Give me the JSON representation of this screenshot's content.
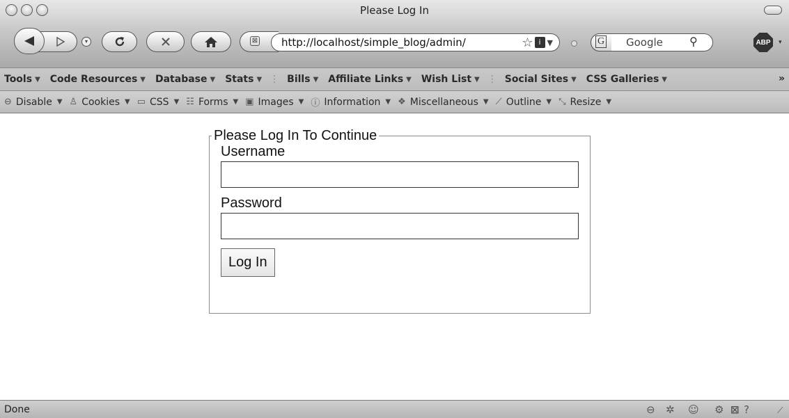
{
  "window": {
    "title": "Please Log In"
  },
  "nav": {
    "back_icon": "back-arrow-icon",
    "forward_icon": "forward-arrow-icon",
    "url": "http://localhost/simple_blog/admin/",
    "search_placeholder": "Google",
    "abp_label": "ABP"
  },
  "bookmarks": [
    {
      "label": "Tools"
    },
    {
      "label": "Code Resources"
    },
    {
      "label": "Database"
    },
    {
      "label": "Stats"
    },
    {
      "label": "Bills"
    },
    {
      "label": "Affiliate Links"
    },
    {
      "label": "Wish List"
    },
    {
      "label": "Social Sites"
    },
    {
      "label": "CSS Galleries"
    }
  ],
  "webdev": [
    {
      "label": "Disable",
      "icon": "disable-icon"
    },
    {
      "label": "Cookies",
      "icon": "cookies-icon"
    },
    {
      "label": "CSS",
      "icon": "css-icon"
    },
    {
      "label": "Forms",
      "icon": "forms-icon"
    },
    {
      "label": "Images",
      "icon": "images-icon"
    },
    {
      "label": "Information",
      "icon": "information-icon"
    },
    {
      "label": "Miscellaneous",
      "icon": "miscellaneous-icon"
    },
    {
      "label": "Outline",
      "icon": "outline-icon"
    },
    {
      "label": "Resize",
      "icon": "resize-icon"
    }
  ],
  "form": {
    "legend": "Please Log In To Continue",
    "username_label": "Username",
    "username_value": "",
    "password_label": "Password",
    "password_value": "",
    "submit_label": "Log In"
  },
  "status": {
    "text": "Done"
  }
}
